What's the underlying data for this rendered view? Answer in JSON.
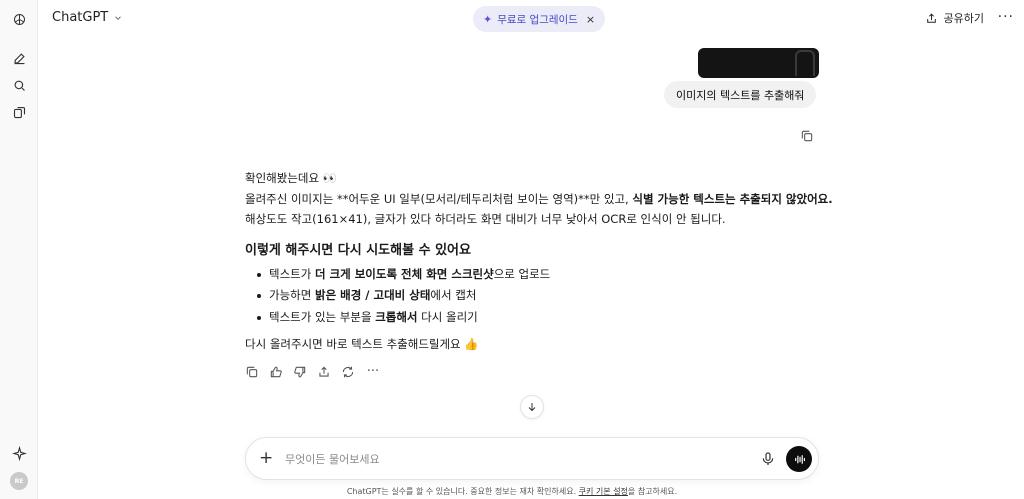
{
  "app": {
    "model_name": "ChatGPT"
  },
  "header": {
    "upgrade_label": "무료로 업그레이드",
    "upgrade_close": "×",
    "share_label": "공유하기",
    "more_label": "···"
  },
  "sidebar": {
    "avatar_initials": "RE"
  },
  "user_message": {
    "text": "이미지의 텍스트를 추출해줘"
  },
  "assistant_message": {
    "line1": "확인해봤는데요 👀",
    "line2_pre": "올려주신 이미지는 **어두운 UI 일부(모서리/테두리처럼 보이는 영역)**만 있고, ",
    "line2_bold": "식별 가능한 텍스트는 추출되지 않았어요.",
    "line3": "해상도도 작고(161×41), 글자가 있다 하더라도 화면 대비가 너무 낮아서 OCR로 인식이 안 됩니다.",
    "heading": "이렇게 해주시면 다시 시도해볼 수 있어요",
    "bullets": [
      {
        "pre": "텍스트가 ",
        "bold": "더 크게 보이도록 전체 화면 스크린샷",
        "post": "으로 업로드"
      },
      {
        "pre": "가능하면 ",
        "bold": "밝은 배경 / 고대비 상태",
        "post": "에서 캡처"
      },
      {
        "pre": "텍스트가 있는 부분을 ",
        "bold": "크롭해서",
        "post": " 다시 올리기"
      }
    ],
    "closing": "다시 올려주시면 바로 텍스트 추출해드릴게요 👍"
  },
  "composer": {
    "placeholder": "무엇이든 물어보세요",
    "plus": "+"
  },
  "footer": {
    "pre": "ChatGPT는 실수를 할 수 있습니다. 중요한 정보는 재차 확인하세요. ",
    "link": "쿠키 기본 설정",
    "post": "을 참고하세요."
  }
}
